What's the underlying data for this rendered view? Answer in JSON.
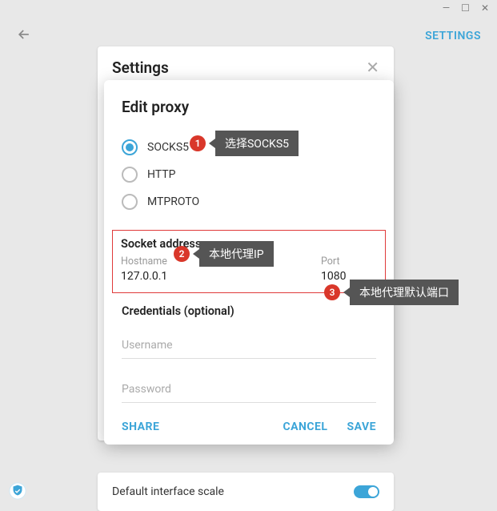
{
  "window_controls": {
    "min": "—",
    "max": "☐",
    "close": "✕"
  },
  "topbar": {
    "settings_link": "SETTINGS"
  },
  "settings_panel": {
    "title": "Settings"
  },
  "bottom_panel": {
    "label": "Default interface scale"
  },
  "dialog": {
    "title": "Edit proxy",
    "radios": {
      "socks5": "SOCKS5",
      "http": "HTTP",
      "mtproto": "MTPROTO"
    },
    "socket_section": "Socket address",
    "hostname_label": "Hostname",
    "hostname_value": "127.0.0.1",
    "port_label": "Port",
    "port_value": "1080",
    "credentials_section": "Credentials (optional)",
    "username_placeholder": "Username",
    "password_placeholder": "Password",
    "share": "SHARE",
    "cancel": "CANCEL",
    "save": "SAVE"
  },
  "annotations": {
    "n1": "1",
    "t1": "选择SOCKS5",
    "n2": "2",
    "t2": "本地代理IP",
    "n3": "3",
    "t3": "本地代理默认端口"
  }
}
